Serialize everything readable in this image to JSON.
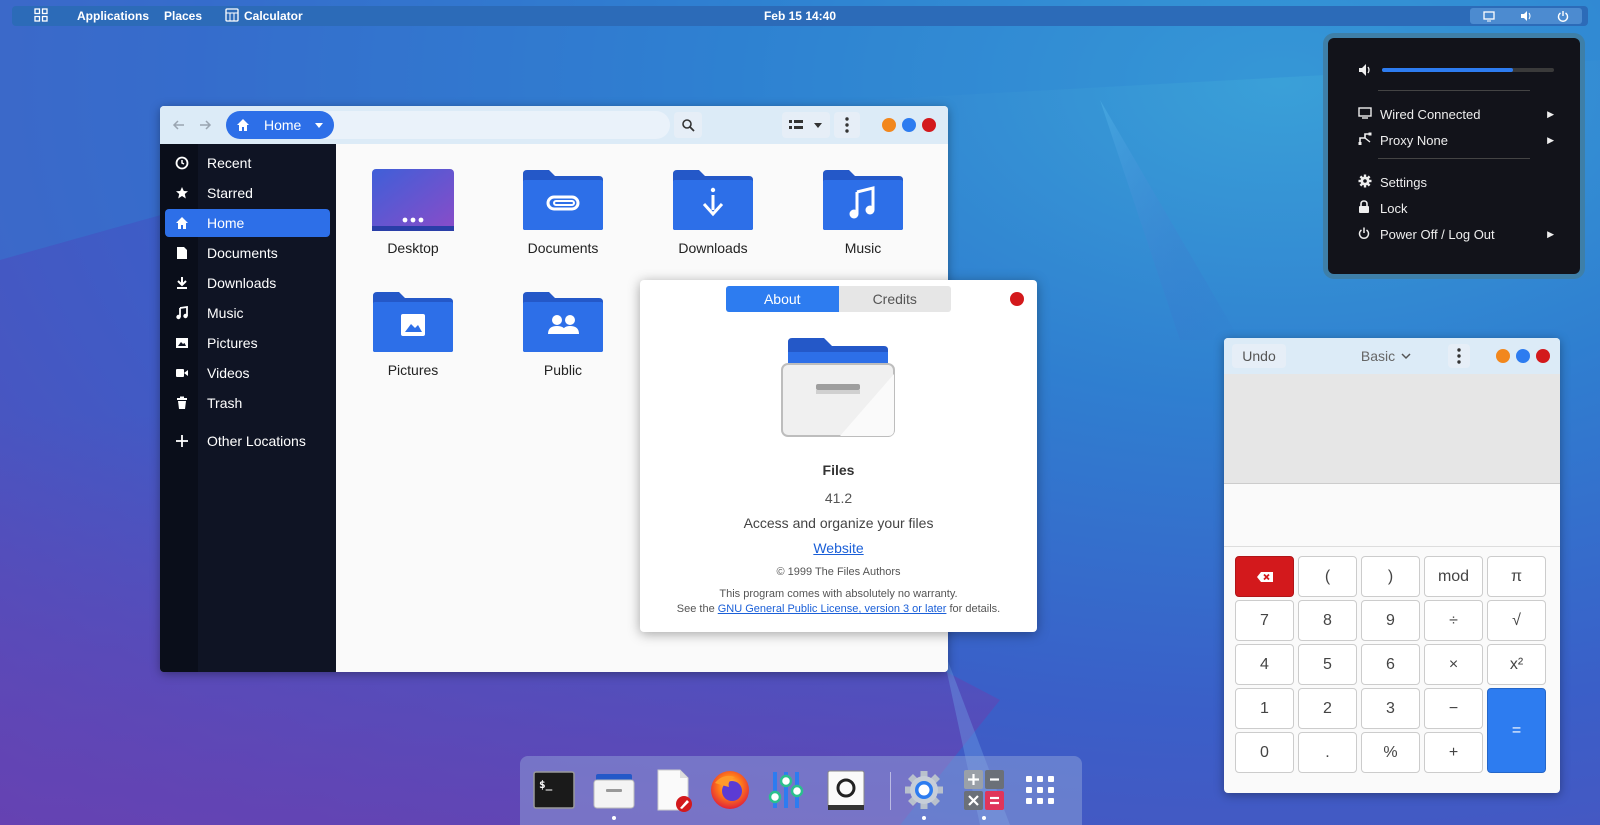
{
  "colors": {
    "accent": "#2d6fe8",
    "close": "#d3191c",
    "minimize": "#f2871d",
    "maximize": "#2d7cf0",
    "sidebar_bg": "#0f1424",
    "folder": "#2d6fe8"
  },
  "topbar": {
    "applications": "Applications",
    "places": "Places",
    "app_name": "Calculator",
    "clock": "Feb 15  14:40",
    "status_icons": [
      "display-icon",
      "volume-icon",
      "power-icon"
    ]
  },
  "files": {
    "location": "Home",
    "sidebar": [
      {
        "label": "Recent",
        "icon": "clock-icon"
      },
      {
        "label": "Starred",
        "icon": "star-icon"
      },
      {
        "label": "Home",
        "icon": "home-icon",
        "active": true
      },
      {
        "label": "Documents",
        "icon": "document-icon"
      },
      {
        "label": "Downloads",
        "icon": "download-icon"
      },
      {
        "label": "Music",
        "icon": "music-icon"
      },
      {
        "label": "Pictures",
        "icon": "picture-icon"
      },
      {
        "label": "Videos",
        "icon": "video-icon"
      },
      {
        "label": "Trash",
        "icon": "trash-icon"
      },
      {
        "label": "Other Locations",
        "icon": "plus-icon"
      }
    ],
    "folders": [
      {
        "label": "Desktop",
        "icon": "desktop-folder-icon"
      },
      {
        "label": "Documents",
        "icon": "documents-folder-icon"
      },
      {
        "label": "Downloads",
        "icon": "downloads-folder-icon"
      },
      {
        "label": "Music",
        "icon": "music-folder-icon"
      },
      {
        "label": "Pictures",
        "icon": "pictures-folder-icon"
      },
      {
        "label": "Public",
        "icon": "public-folder-icon"
      }
    ]
  },
  "about": {
    "tabs": [
      "About",
      "Credits"
    ],
    "app_name": "Files",
    "version": "41.2",
    "description": "Access and organize your files",
    "website": "Website",
    "copyright": "© 1999 The Files Authors",
    "warranty": "This program comes with absolutely no warranty.",
    "license_prefix": "See the",
    "license_link": "GNU General Public License, version 3 or later",
    "license_suffix": "for details."
  },
  "quick_settings": {
    "volume_level": 0.76,
    "items": [
      {
        "label": "Wired Connected",
        "icon": "network-icon",
        "submenu": true
      },
      {
        "label": "Proxy None",
        "icon": "proxy-icon",
        "submenu": true
      },
      {
        "label": "Settings",
        "icon": "gear-icon",
        "submenu": false
      },
      {
        "label": "Lock",
        "icon": "lock-icon",
        "submenu": false
      },
      {
        "label": "Power Off / Log Out",
        "icon": "power-icon",
        "submenu": true
      }
    ]
  },
  "calculator": {
    "undo": "Undo",
    "mode": "Basic",
    "keys": [
      [
        "⌫",
        "(",
        ")",
        "mod",
        "π"
      ],
      [
        "7",
        "8",
        "9",
        "÷",
        "√"
      ],
      [
        "4",
        "5",
        "6",
        "×",
        "x²"
      ],
      [
        "1",
        "2",
        "3",
        "−",
        "="
      ],
      [
        "0",
        ".",
        "%",
        "+"
      ]
    ]
  },
  "dock": {
    "apps": [
      {
        "name": "terminal",
        "running": false
      },
      {
        "name": "files",
        "running": true
      },
      {
        "name": "text-editor",
        "running": false
      },
      {
        "name": "firefox",
        "running": false
      },
      {
        "name": "tweaks",
        "running": false
      },
      {
        "name": "screenshot",
        "running": false
      },
      {
        "name": "settings",
        "running": true
      },
      {
        "name": "calculator",
        "running": true
      },
      {
        "name": "app-grid",
        "running": false
      }
    ]
  }
}
